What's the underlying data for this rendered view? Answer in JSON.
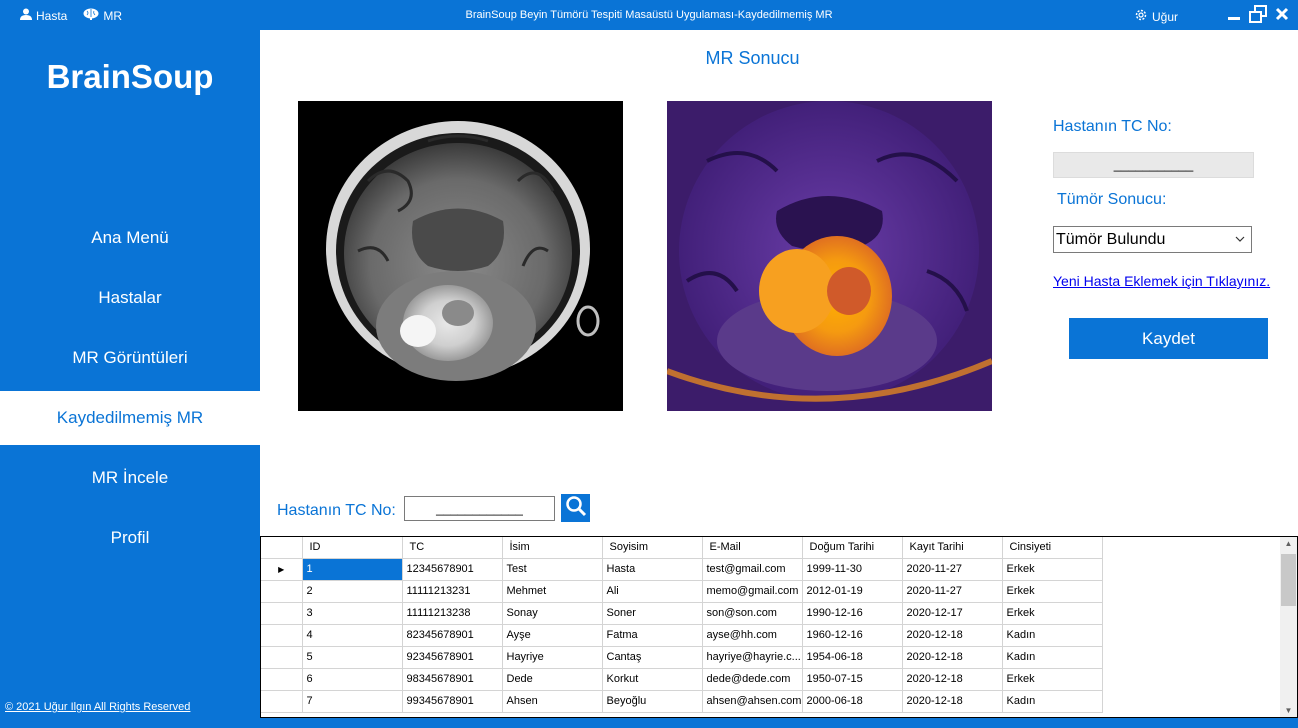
{
  "titlebar": {
    "hasta": "Hasta",
    "mr": "MR",
    "title": "BrainSoup Beyin Tümörü Tespiti Masaüstü Uygulaması-Kaydedilmemiş MR",
    "user": "Uğur"
  },
  "sidebar": {
    "logo": "BrainSoup",
    "items": [
      {
        "label": "Ana Menü"
      },
      {
        "label": "Hastalar"
      },
      {
        "label": "MR Görüntüleri"
      },
      {
        "label": "Kaydedilmemiş MR"
      },
      {
        "label": "MR İncele"
      },
      {
        "label": "Profil"
      }
    ],
    "active_index": 3,
    "footer": "© 2021 Uğur Ilgın All Rights Reserved"
  },
  "main": {
    "title": "MR Sonucu",
    "tc_label": "Hastanın TC No:",
    "tc_value": "___________",
    "tumor_label": "Tümör Sonucu:",
    "tumor_value": "Tümör Bulundu",
    "new_patient_link": "Yeni Hasta Eklemek için Tıklayınız.",
    "save_button": "Kaydet"
  },
  "search": {
    "label": "Hastanın TC No:",
    "value": "____________"
  },
  "table": {
    "columns": [
      "ID",
      "TC",
      "İsim",
      "Soyisim",
      "E-Mail",
      "Doğum Tarihi",
      "Kayıt Tarihi",
      "Cinsiyeti"
    ],
    "rows": [
      [
        "1",
        "12345678901",
        "Test",
        "Hasta",
        "test@gmail.com",
        "1999-11-30",
        "2020-11-27",
        "Erkek"
      ],
      [
        "2",
        "11111213231",
        "Mehmet",
        "Ali",
        "memo@gmail.com",
        "2012-01-19",
        "2020-11-27",
        "Erkek"
      ],
      [
        "3",
        "11111213238",
        "Sonay",
        "Soner",
        "son@son.com",
        "1990-12-16",
        "2020-12-17",
        "Erkek"
      ],
      [
        "4",
        "82345678901",
        "Ayşe",
        "Fatma",
        "ayse@hh.com",
        "1960-12-16",
        "2020-12-18",
        "Kadın"
      ],
      [
        "5",
        "92345678901",
        "Hayriye",
        "Cantaş",
        "hayriye@hayrie.c...",
        "1954-06-18",
        "2020-12-18",
        "Kadın"
      ],
      [
        "6",
        "98345678901",
        "Dede",
        "Korkut",
        "dede@dede.com",
        "1950-07-15",
        "2020-12-18",
        "Erkek"
      ],
      [
        "7",
        "99345678901",
        "Ahsen",
        "Beyoğlu",
        "ahsen@ahsen.com",
        "2000-06-18",
        "2020-12-18",
        "Kadın"
      ]
    ],
    "selected_row": 0
  },
  "colors": {
    "accent": "#0a74d6",
    "link": "#0000ee"
  },
  "icons": {
    "user": "user-icon",
    "mr": "brain-icon",
    "settings": "gear-icon",
    "minimize": "minimize-icon",
    "restore": "restore-icon",
    "close": "close-icon",
    "search": "search-icon",
    "dropdown": "chevron-down-icon"
  }
}
